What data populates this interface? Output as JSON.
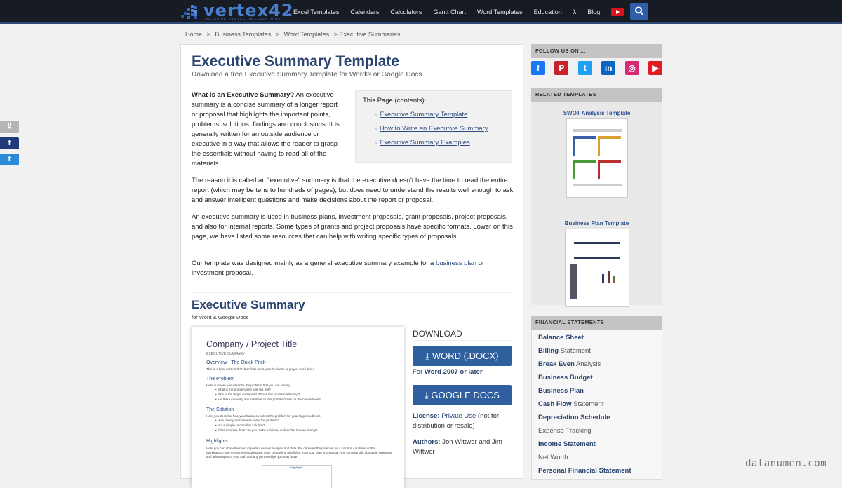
{
  "header": {
    "logo_text": "vertex42",
    "logo_tagline": "THE GUIDE TO EXCEL IN EVERYTHING",
    "nav": [
      "Excel Templates",
      "Calendars",
      "Calculators",
      "Gantt Chart",
      "Word Templates",
      "Education",
      "λ",
      "Blog"
    ],
    "youtube_icon": "youtube-icon",
    "search_icon": "search-icon"
  },
  "breadcrumb": [
    "Home",
    ">",
    "Business Templates",
    ">",
    "Word Templates",
    "> Executive Summaries"
  ],
  "page": {
    "title": "Executive Summary Template",
    "subtitle": "Download a free Executive Summary Template for Word® or Google Docs",
    "intro_bold": "What is an Executive Summary?",
    "intro_text": " An executive summary is a concise summary of a longer report or proposal that highlights the important points, problems, solutions, findings and conclusions. It is generally written for an outside audience or executive in a way that allows the reader to grasp the essentials without having to read all of the materials.",
    "toc": {
      "title": "This Page (contents):",
      "items": [
        "Executive Summary Template",
        "How to Write an Executive Summary",
        "Executive Summary Examples"
      ]
    },
    "para1": "The reason it is called an \"executive\" summary is that the executive doesn't have the time to read the entire report (which may be tens to hundreds of pages), but does need to understand the results well enough to ask and answer intelligent questions and make decisions about the report or proposal.",
    "para2": "An executive summary is used in business plans, investment proposals, grant proposals, project proposals, and also for internal reports. Some types of grants and project proposals have specific formats. Lower on this page, we have listed some resources that can help with writing specific types of proposals.",
    "para3_before": "Our template was designed mainly as a general executive summary example for a ",
    "para3_link": "business plan",
    "para3_after": " or investment proposal.",
    "section_title": "Executive Summary",
    "section_sub": "for Word & Google Docs"
  },
  "preview": {
    "title": "Company / Project Title",
    "small": "EXECUTIVE SUMMARY",
    "h1": "Overview - The Quick Pitch",
    "t1": "This is a brief section that describes what your business or project is all about.",
    "h2": "The Problem",
    "t2": "Here is where you describe the problem that you are solving.",
    "b2": [
      "What is the problem and how big is it?",
      "Who is the target audience? Who is this problem affecting?",
      "Are there currently any solutions to this problem? Who is the competition?"
    ],
    "h3": "The Solution",
    "t3": "Here you describe how your business solves the problem for your target audience.",
    "b3": [
      "How does your business solve the problem?",
      "Is it a simple or complex solution?",
      "If it is complex, how can you make it simple, or describe it more simply?"
    ],
    "h4": "Highlights",
    "t4": "Here you can show the most important market analysis and data that captures the potential your solution can have in the marketplace. We recommend pulling the most compelling highlights from your plan or proposal. You can also talk about the strengths and advantages of your staff and any partnerships you may have.",
    "chart_label": "Highlights"
  },
  "download": {
    "label": "DOWNLOAD",
    "word_button": "⤓ WORD (.DOCX)",
    "for_prefix": "For ",
    "for_bold": "Word 2007 or later",
    "gdocs_button": "⤓ GOOGLE DOCS",
    "license_label": "License:",
    "license_link": "Private Use",
    "license_rest": " (not for distribution or resale)",
    "authors_label": "Authors:",
    "authors": " Jon Wittwer and Jim Wittwer"
  },
  "sidebar": {
    "follow_title": "FOLLOW US ON ...",
    "social": [
      {
        "name": "facebook",
        "glyph": "f",
        "color": "#1877f2"
      },
      {
        "name": "pinterest",
        "glyph": "P",
        "color": "#c8232c"
      },
      {
        "name": "twitter",
        "glyph": "t",
        "color": "#1da1f2"
      },
      {
        "name": "linkedin",
        "glyph": "in",
        "color": "#0a66c2"
      },
      {
        "name": "instagram",
        "glyph": "◎",
        "color": "#d62976"
      },
      {
        "name": "youtube",
        "glyph": "▶",
        "color": "#e01b22"
      }
    ],
    "related_title": "RELATED TEMPLATES",
    "related": [
      "SWOT Analysis Template",
      "Business Plan Template"
    ],
    "fin_title": "FINANCIAL STATEMENTS",
    "fin_items": [
      {
        "bold": "Balance Sheet",
        "rest": ""
      },
      {
        "bold": "Billing",
        "rest": " Statement"
      },
      {
        "bold": "Break Even",
        "rest": " Analysis"
      },
      {
        "bold": "Business Budget",
        "rest": ""
      },
      {
        "bold": "Business Plan",
        "rest": ""
      },
      {
        "bold": "Cash Flow",
        "rest": " Statement"
      },
      {
        "bold": "Depreciation Schedule",
        "rest": ""
      },
      {
        "bold": "",
        "rest": "Expense Tracking"
      },
      {
        "bold": "Income Statement",
        "rest": ""
      },
      {
        "bold": "",
        "rest": "Net Worth"
      },
      {
        "bold": "Personal Financial Statement",
        "rest": ""
      }
    ]
  },
  "share": [
    "share-icon",
    "f",
    "t"
  ],
  "watermark": "datanumen.com"
}
